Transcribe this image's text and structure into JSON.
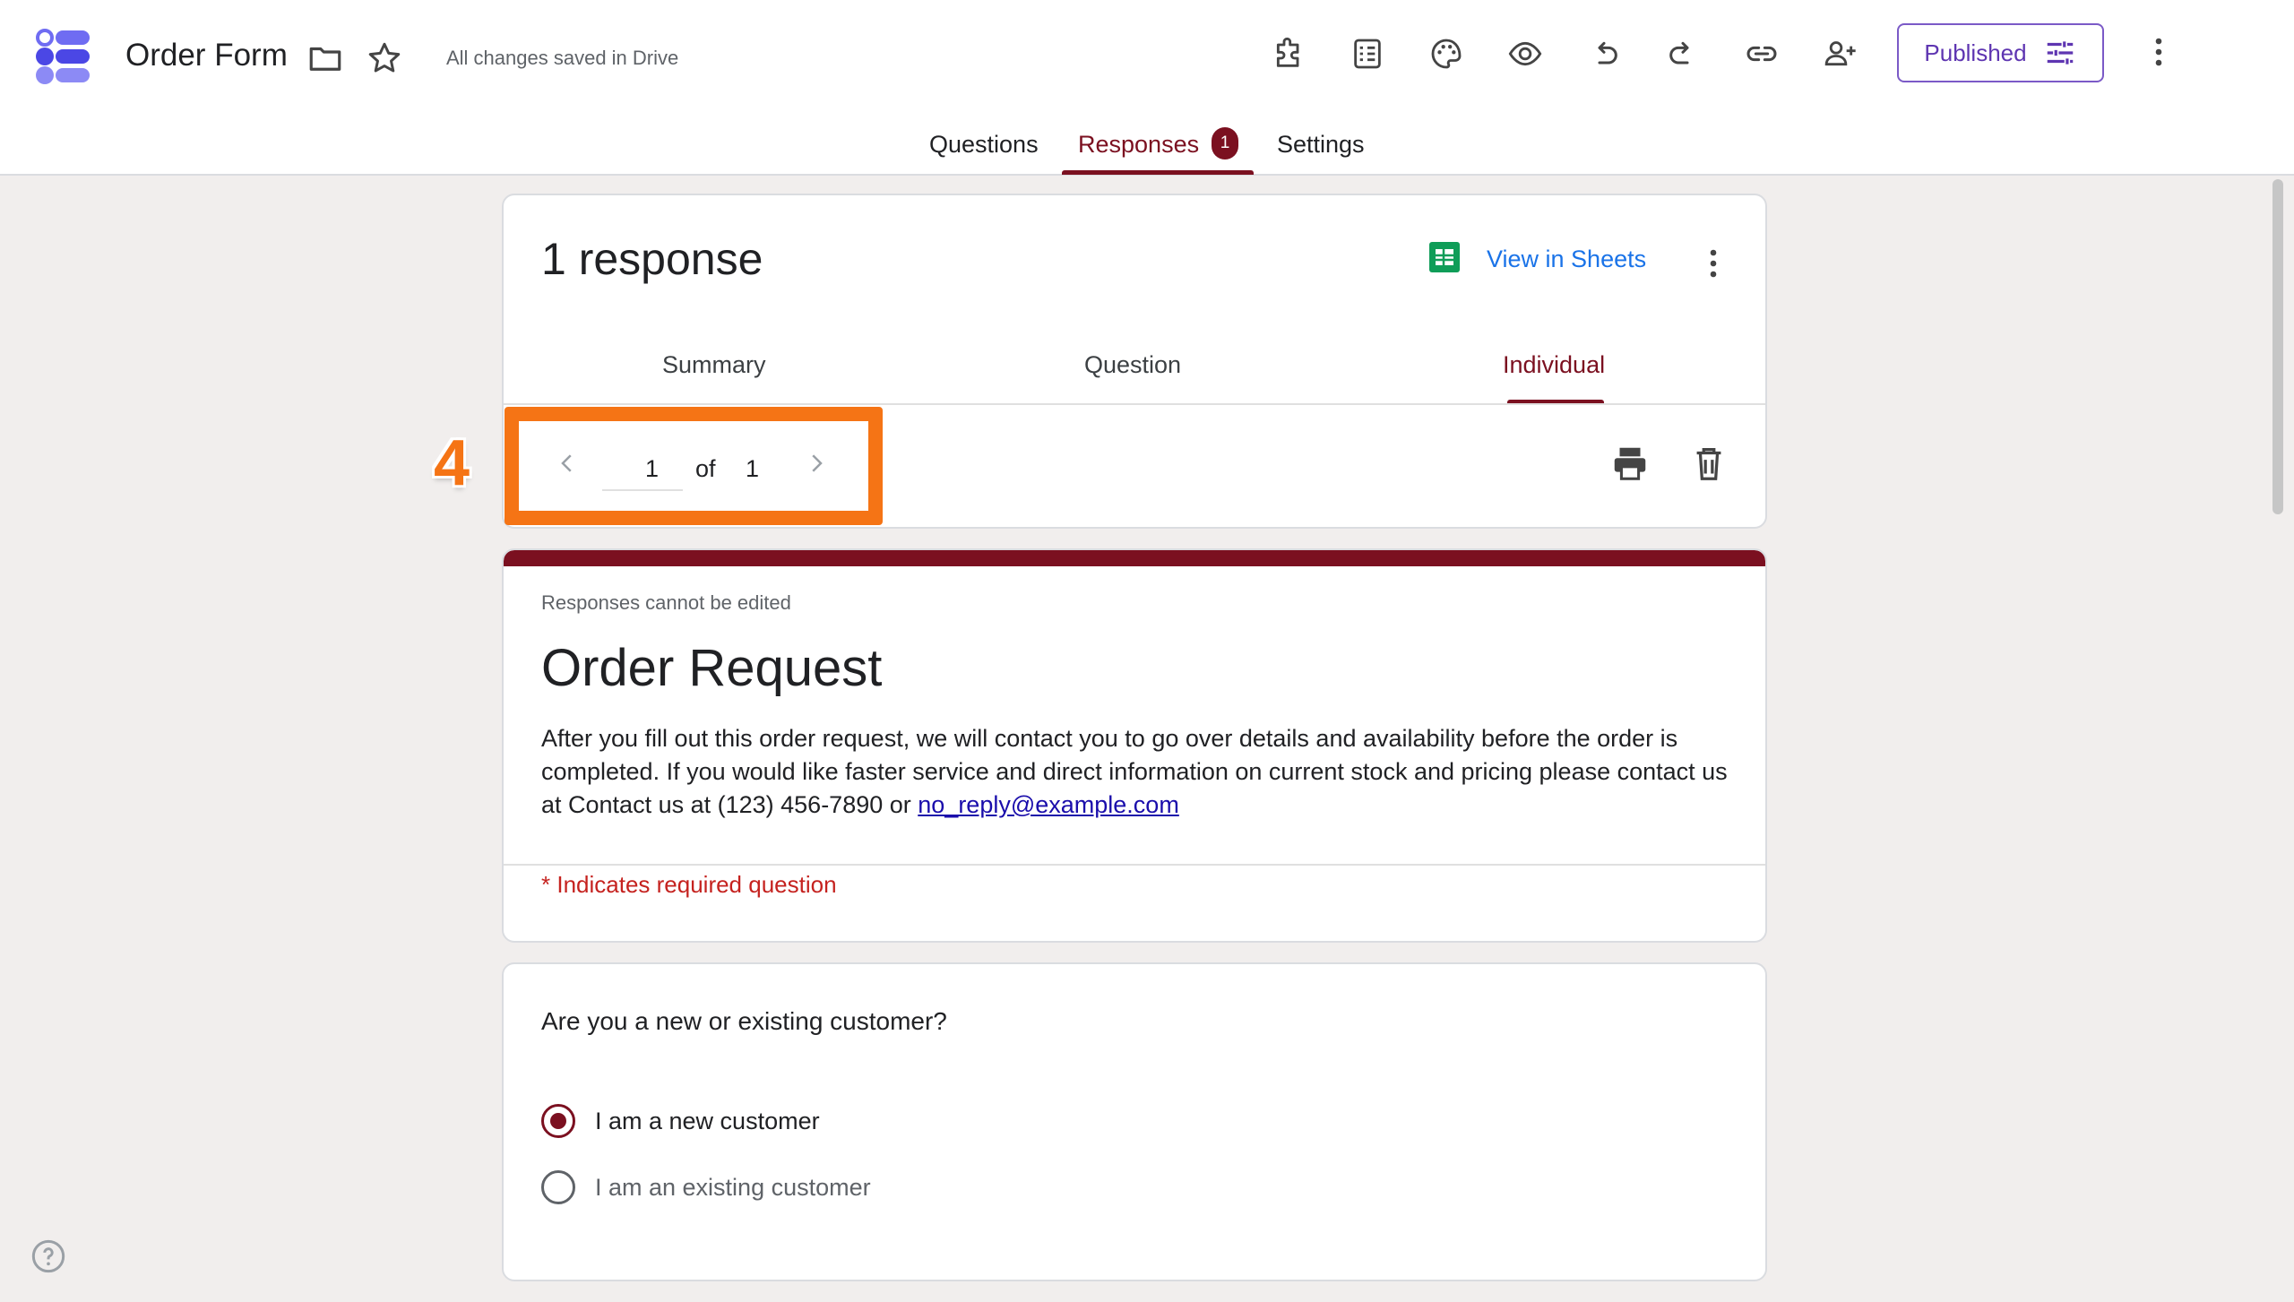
{
  "app": {
    "title": "Order Form",
    "save_status": "All changes saved in Drive",
    "publish_label": "Published"
  },
  "tabs": [
    {
      "label": "Questions",
      "active": false
    },
    {
      "label": "Responses",
      "active": true,
      "badge": "1"
    },
    {
      "label": "Settings",
      "active": false
    }
  ],
  "responses": {
    "count_label": "1 response",
    "view_in_sheets": "View in Sheets",
    "subtabs": [
      {
        "label": "Summary",
        "active": false
      },
      {
        "label": "Question",
        "active": false
      },
      {
        "label": "Individual",
        "active": true
      }
    ],
    "pager": {
      "current": "1",
      "of_label": "of",
      "total": "1"
    }
  },
  "annotation": {
    "step": "4",
    "color": "#f57415"
  },
  "form": {
    "note": "Responses cannot be edited",
    "title": "Order Request",
    "description": "After you fill out this order request, we will contact you to go over details and availability before the order is completed. If you would like faster service and direct information on current stock and pricing please contact us at Contact us at (123) 456-7890 or ",
    "email": "no_reply@example.com",
    "required_note": "* Indicates required question"
  },
  "question1": {
    "text": "Are you a new or existing customer?",
    "options": [
      {
        "label": "I am a new customer",
        "selected": true
      },
      {
        "label": "I am an existing customer",
        "selected": false
      }
    ]
  },
  "colors": {
    "accent": "#7b1020",
    "link": "#1a73e8",
    "publish": "#5e35b1",
    "sheets": "#0f9d58"
  },
  "icons": [
    "forms-logo-icon",
    "folder-icon",
    "star-icon",
    "addon-icon",
    "quiz-icon",
    "palette-icon",
    "preview-eye-icon",
    "undo-icon",
    "redo-icon",
    "link-icon",
    "add-collaborator-icon",
    "sliders-icon",
    "more-vert-icon",
    "sheets-icon",
    "chevron-left-icon",
    "chevron-right-icon",
    "print-icon",
    "trash-icon",
    "help-icon"
  ]
}
